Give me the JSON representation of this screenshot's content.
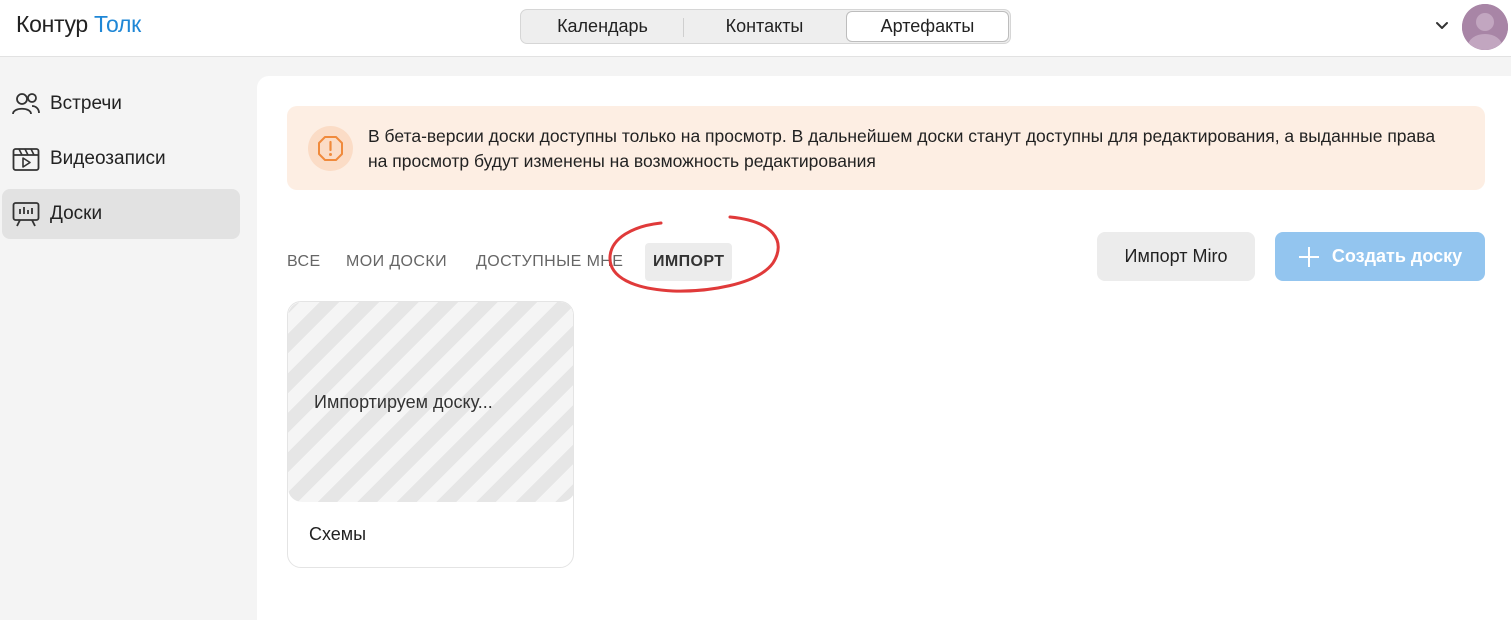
{
  "header": {
    "logo": {
      "brand": "Контур",
      "product": "Толк"
    },
    "tabs": [
      {
        "label": "Календарь"
      },
      {
        "label": "Контакты"
      },
      {
        "label": "Артефакты"
      }
    ]
  },
  "sidebar": {
    "items": [
      {
        "label": "Встречи",
        "icon": "people-icon"
      },
      {
        "label": "Видеозаписи",
        "icon": "video-icon"
      },
      {
        "label": "Доски",
        "icon": "board-icon",
        "active": true
      }
    ]
  },
  "banner": {
    "text": "В бета-версии доски доступны только на просмотр. В дальнейшем доски станут доступны для редактирования, а выданные права на просмотр будут изменены на возможность редактирования"
  },
  "filters": [
    {
      "label": "ВСЕ"
    },
    {
      "label": "МОИ ДОСКИ"
    },
    {
      "label": "ДОСТУПНЫЕ МНЕ"
    },
    {
      "label": "ИМПОРТ",
      "active": true
    }
  ],
  "actions": {
    "import_label": "Импорт Miro",
    "create_label": "Создать доску"
  },
  "boards": [
    {
      "status": "Импортируем доску...",
      "name": "Схемы"
    }
  ],
  "colors": {
    "accent": "#1f87d6",
    "create_button": "#93c5ef",
    "banner_bg": "#fdeee3",
    "warning": "#f08a3c",
    "annotation": "#e03a3a"
  }
}
